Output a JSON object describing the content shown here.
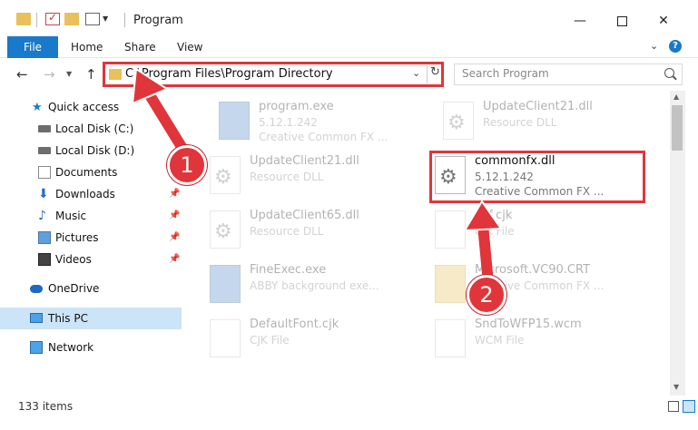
{
  "window": {
    "title": "Program",
    "minimize": "—",
    "close": "✕"
  },
  "ribbon": {
    "file": "File",
    "home": "Home",
    "share": "Share",
    "view": "View",
    "help": "?"
  },
  "nav": {
    "back": "←",
    "forward": "→",
    "up": "↑",
    "address": "C:\\Program Files\\Program Directory",
    "search_placeholder": "Search Program"
  },
  "sidebar": {
    "items": [
      {
        "label": "Quick access",
        "icon": "star-icon"
      },
      {
        "label": "Local Disk (C:)",
        "icon": "drive-icon"
      },
      {
        "label": "Local Disk (D:)",
        "icon": "drive-icon"
      },
      {
        "label": "Documents",
        "icon": "documents-icon"
      },
      {
        "label": "Downloads",
        "icon": "downloads-icon"
      },
      {
        "label": "Music",
        "icon": "music-icon"
      },
      {
        "label": "Pictures",
        "icon": "pictures-icon"
      },
      {
        "label": "Videos",
        "icon": "videos-icon"
      },
      {
        "label": "OneDrive",
        "icon": "onedrive-icon"
      },
      {
        "label": "This PC",
        "icon": "this-pc-icon"
      },
      {
        "label": "Network",
        "icon": "network-icon"
      }
    ]
  },
  "files": [
    {
      "name": "program.exe",
      "line2": "5.12.1.242",
      "line3": "Creative Common FX ..."
    },
    {
      "name": "UpdateClient21.dll",
      "line2": "Resource DLL",
      "line3": ""
    },
    {
      "name": "UpdateClient21.dll",
      "line2": "Resource DLL",
      "line3": ""
    },
    {
      "name": "commonfx.dll",
      "line2": "5.12.1.242",
      "line3": "Creative Common FX ..."
    },
    {
      "name": "UpdateClient65.dll",
      "line2": "Resource DLL",
      "line3": ""
    },
    {
      "name": "dcf.cjk",
      "line2": "CJK File",
      "line3": ""
    },
    {
      "name": "FineExec.exe",
      "line2": "ABBY background exe...",
      "line3": ""
    },
    {
      "name": "Microsoft.VC90.CRT",
      "line2": "Creative Common FX ...",
      "line3": ""
    },
    {
      "name": "DefaultFont.cjk",
      "line2": "CJK File",
      "line3": ""
    },
    {
      "name": "SndToWFP15.wcm",
      "line2": "WCM File",
      "line3": ""
    }
  ],
  "status": {
    "count": "133 items"
  },
  "annotations": {
    "step1": "1",
    "step2": "2"
  },
  "colors": {
    "accent": "#1979ca",
    "annotation_red": "#e0353b"
  }
}
